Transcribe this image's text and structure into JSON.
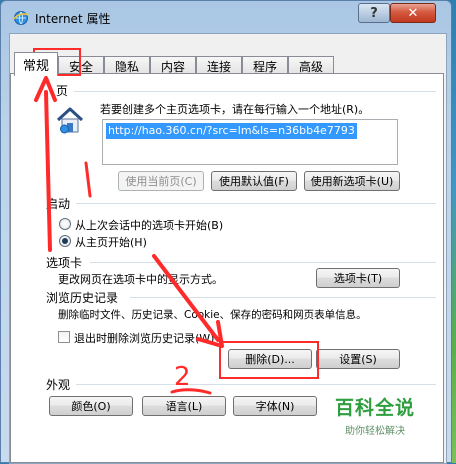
{
  "window": {
    "title": "Internet 属性",
    "help_label": "?",
    "close_label": "✕"
  },
  "tabs": [
    "常规",
    "安全",
    "隐私",
    "内容",
    "连接",
    "程序",
    "高级"
  ],
  "active_tab": "常规",
  "home": {
    "section_label": "页",
    "description": "若要创建多个主页选项卡，请在每行输入一个地址(R)。",
    "url": "http://hao.360.cn/?src=lm&ls=n36bb4e7793",
    "btn_current": "使用当前页(C)",
    "btn_default": "使用默认值(F)",
    "btn_new_tab": "使用新选项卡(U)"
  },
  "startup": {
    "section_label": "启动",
    "option_last_session": "从上次会话中的选项卡开始(B)",
    "option_home": "从主页开始(H)",
    "selected": "option_home"
  },
  "tabs_section": {
    "section_label": "选项卡",
    "description": "更改网页在选项卡中的显示方式。",
    "button": "选项卡(T)"
  },
  "history": {
    "section_label": "浏览历史记录",
    "description": "删除临时文件、历史记录、Cookie、保存的密码和网页表单信息。",
    "checkbox_label": "退出时删除浏览历史记录(W)",
    "checkbox_checked": false,
    "btn_delete": "删除(D)...",
    "btn_settings": "设置(S)"
  },
  "appearance": {
    "section_label": "外观",
    "btn_colors": "颜色(O)",
    "btn_languages": "语言(L)",
    "btn_fonts": "字体(N)"
  },
  "annotation": {
    "number_label": "2",
    "color": "#ff2a2a"
  },
  "watermark": {
    "main": "百科全说",
    "sub": "助你轻松解决"
  },
  "icons": {
    "title_icon": "ie-globe-icon",
    "home_icon": "home-icon"
  }
}
